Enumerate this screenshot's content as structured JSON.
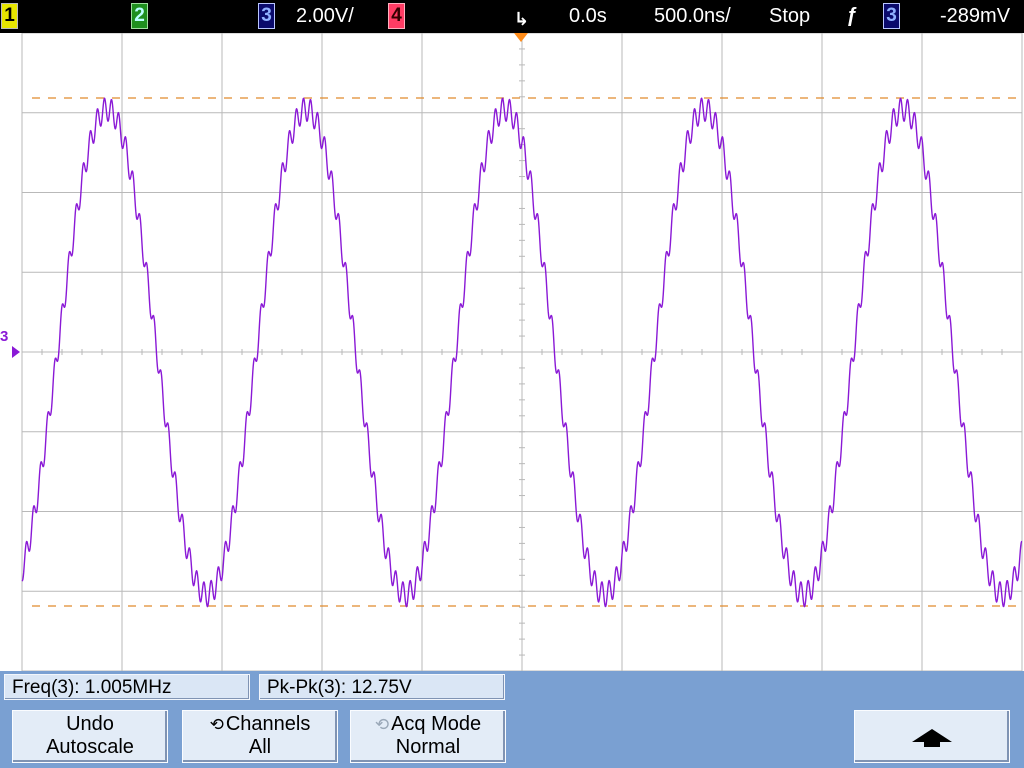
{
  "top_bar": {
    "ch1_label": "1",
    "ch2_label": "2",
    "ch3_label": "3",
    "ch3_scale": "2.00V/",
    "ch4_label": "4",
    "time_delay": "0.0s",
    "time_base": "500.0ns/",
    "run_state": "Stop",
    "trigger_slope_icon": "rising-edge-icon",
    "trigger_slope_glyph": "ƒ",
    "trigger_source": "3",
    "trigger_level": "-289mV",
    "trigger_marker_glyph": "↳"
  },
  "colors": {
    "channel1": "#e7e600",
    "channel2": "#1f8f1f",
    "channel3_trace": "#8a19d6",
    "channel4": "#ff3c64",
    "cursor": "#e08a2c",
    "grid": "#b9b9b9",
    "background_panel": "#7aa0d2"
  },
  "screen": {
    "ground_marker": "3"
  },
  "measurements": {
    "frequency": "Freq(3): 1.005MHz",
    "peak_to_peak": "Pk-Pk(3): 12.75V"
  },
  "softkeys": {
    "undo_line1": "Undo",
    "undo_line2": "Autoscale",
    "channels_icon_glyph": "⟲",
    "channels_line1": "Channels",
    "channels_line2": "All",
    "acq_icon_glyph": "⟲",
    "acq_line1": "Acq Mode",
    "acq_line2": "Normal",
    "menu_up_icon": "up-arrow-icon"
  },
  "chart_data": {
    "type": "line",
    "series": [
      {
        "name": "3",
        "waveform": "sine with superimposed high-frequency ripple",
        "frequency_hz": 1005000,
        "peak_to_peak_v": 12.75,
        "offset_v": 0
      }
    ],
    "x_unit": "s",
    "x_scale_per_div": "500.0ns",
    "x_range": [
      -2.5e-06,
      2.5e-06
    ],
    "y_unit": "V",
    "y_scale_per_div": "2.00V",
    "y_range": [
      -8,
      8
    ],
    "cursor_levels_v": [
      6.37,
      -6.37
    ],
    "grid": true,
    "divisions_x": 10,
    "divisions_y": 8
  }
}
